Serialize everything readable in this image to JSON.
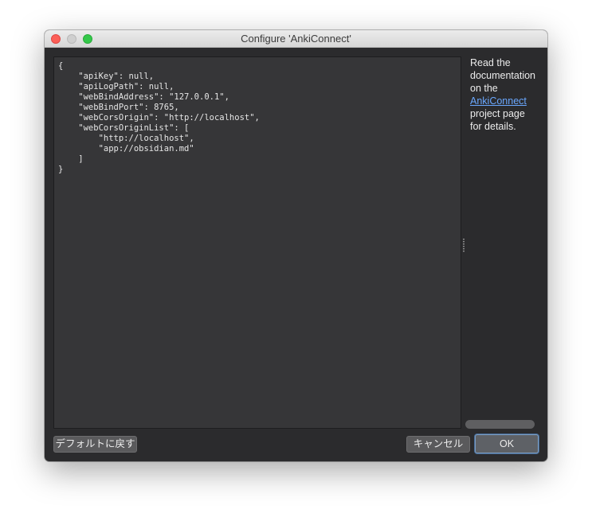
{
  "window": {
    "title": "Configure 'AnkiConnect'"
  },
  "editor": {
    "content": "{\n    \"apiKey\": null,\n    \"apiLogPath\": null,\n    \"webBindAddress\": \"127.0.0.1\",\n    \"webBindPort\": 8765,\n    \"webCorsOrigin\": \"http://localhost\",\n    \"webCorsOriginList\": [\n        \"http://localhost\",\n        \"app://obsidian.md\"\n    ]\n}"
  },
  "help": {
    "line1": "Read the",
    "line2": "documentation",
    "line3": "on the",
    "link": "AnkiConnect",
    "line4": "project page",
    "line5": "for details."
  },
  "buttons": {
    "restore_defaults": "デフォルトに戻す",
    "cancel": "キャンセル",
    "ok": "OK"
  },
  "colors": {
    "window_bg": "#2b2b2d",
    "editor_bg": "#363638",
    "link": "#6aa8ff",
    "close": "#fc5f57",
    "zoom": "#34c84a"
  },
  "icons": {
    "close": "close-traffic-light",
    "minimize": "minimize-traffic-light",
    "zoom": "zoom-traffic-light"
  }
}
